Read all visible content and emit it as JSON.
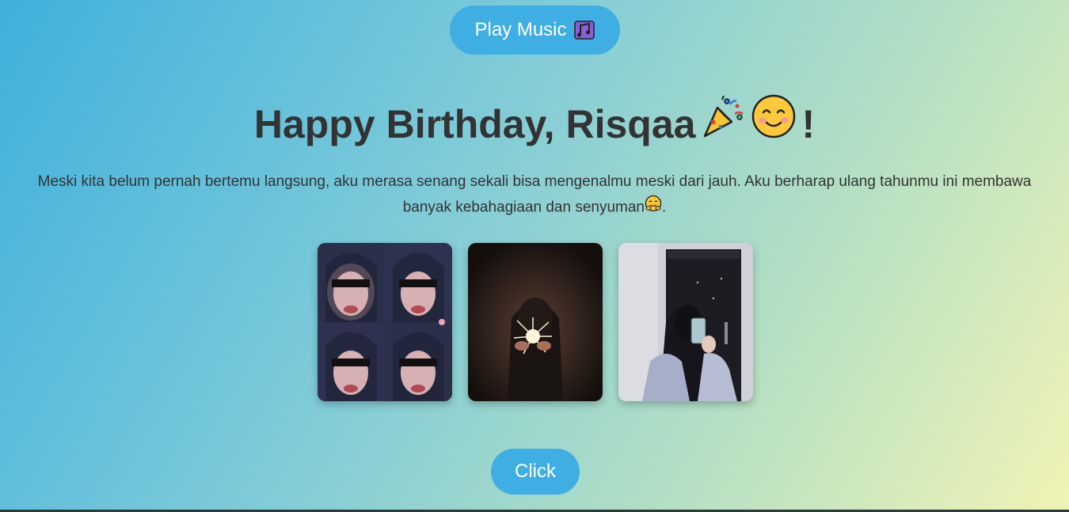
{
  "music_button": {
    "label": "Play Music",
    "icon": "music-notes-icon"
  },
  "heading": {
    "text": "Happy Birthday, Risqaa",
    "suffix": "!",
    "emojis": [
      "party-popper-icon",
      "smiling-face-icon"
    ]
  },
  "message": {
    "text": "Meski kita belum pernah bertemu langsung, aku merasa senang sekali bisa mengenalmu meski dari jauh. Aku berharap ulang tahunmu ini membawa banyak kebahagiaan dan senyuman",
    "end_emoji": "hugging-face-icon",
    "end_punct": "."
  },
  "gallery": {
    "photos": [
      "photo-collage-sunglasses",
      "photo-sparkler",
      "photo-mirror-selfie"
    ]
  },
  "click_button": {
    "label": "Click"
  },
  "colors": {
    "accent": "#3eaee3",
    "text": "#333333"
  }
}
